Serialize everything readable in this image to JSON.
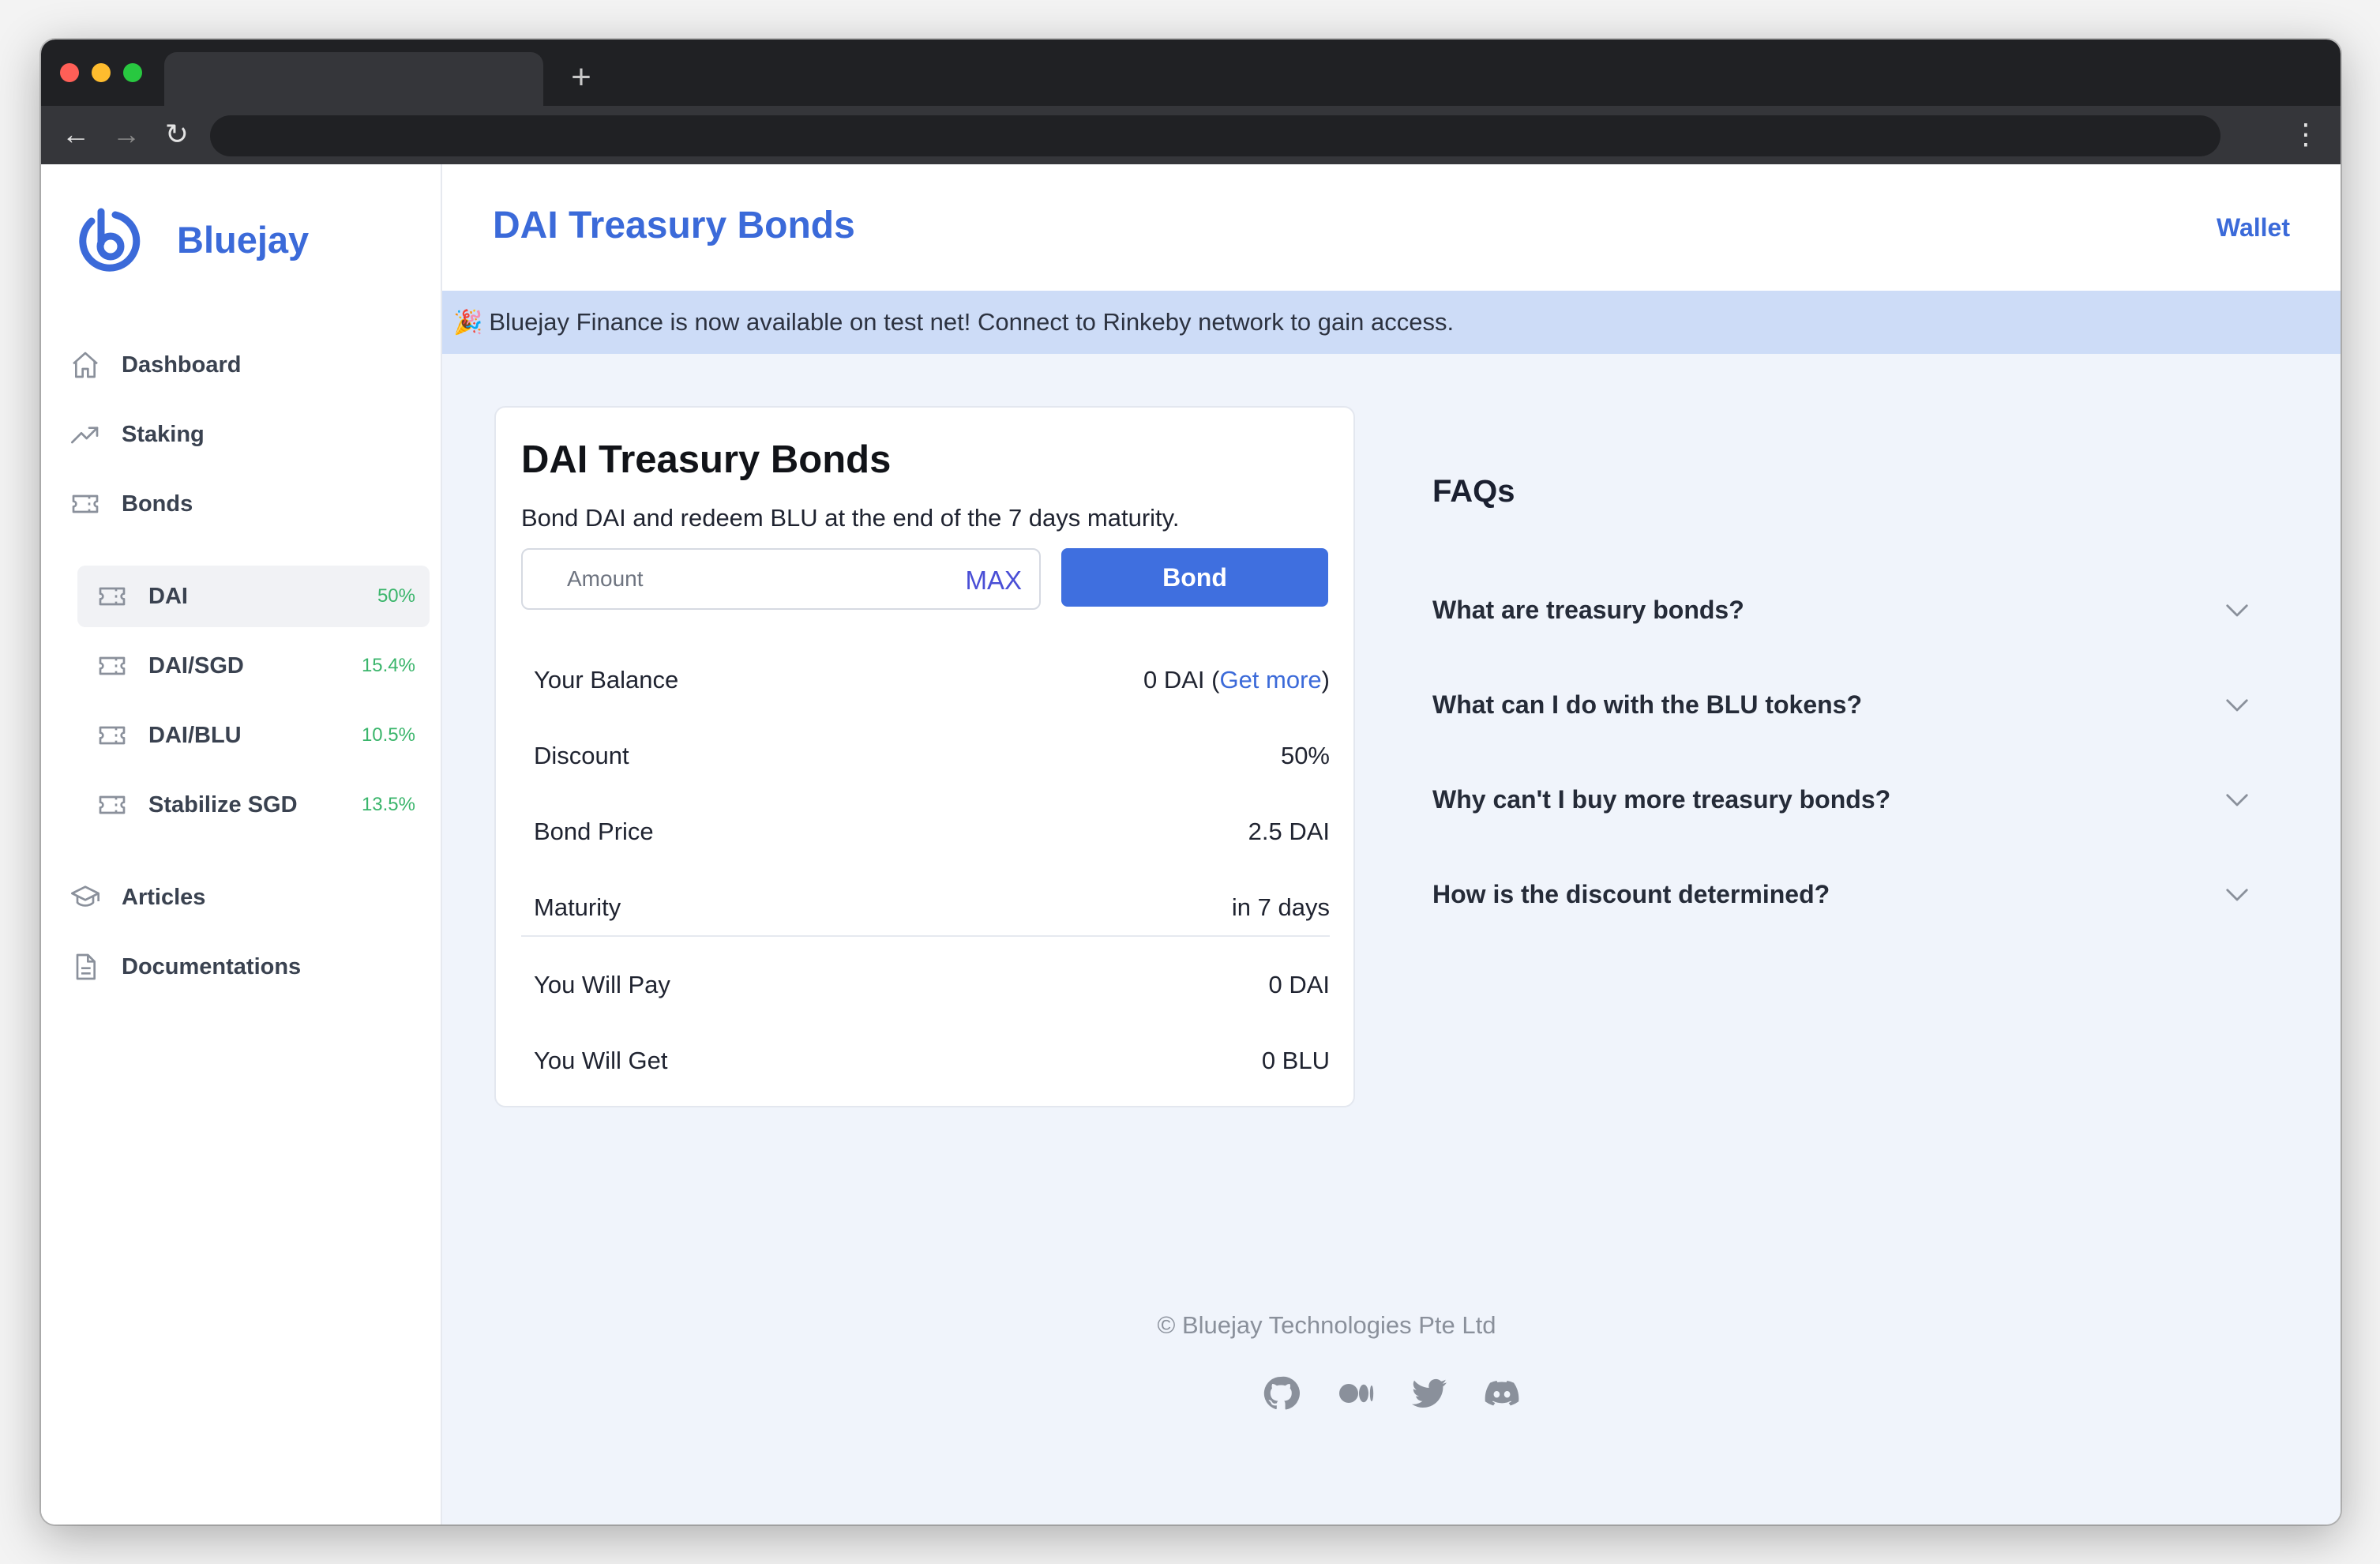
{
  "browser": {
    "new_tab_label": "+",
    "back_glyph": "←",
    "forward_glyph": "→",
    "reload_glyph": "↻",
    "menu_glyph": "⋮"
  },
  "sidebar": {
    "brand": "Bluejay",
    "items": [
      {
        "label": "Dashboard",
        "icon": "home-icon"
      },
      {
        "label": "Staking",
        "icon": "trending-up-icon"
      },
      {
        "label": "Bonds",
        "icon": "ticket-icon"
      },
      {
        "label": "Articles",
        "icon": "graduation-cap-icon"
      },
      {
        "label": "Documentations",
        "icon": "document-icon"
      }
    ],
    "bonds": [
      {
        "label": "DAI",
        "pct": "50%",
        "active": true
      },
      {
        "label": "DAI/SGD",
        "pct": "15.4%"
      },
      {
        "label": "DAI/BLU",
        "pct": "10.5%"
      },
      {
        "label": "Stabilize SGD",
        "pct": "13.5%"
      }
    ]
  },
  "header": {
    "title": "DAI Treasury Bonds",
    "wallet": "Wallet"
  },
  "banner": {
    "emoji": "🎉",
    "text": "Bluejay Finance is now available on test net! Connect to Rinkeby network to gain access."
  },
  "bond_card": {
    "title": "DAI Treasury Bonds",
    "subtitle": "Bond DAI and redeem BLU at the end of the 7 days maturity.",
    "amount_placeholder": "Amount",
    "max_label": "MAX",
    "bond_label": "Bond",
    "balance_label": "Your Balance",
    "balance_value": "0 DAI",
    "balance_open": "(",
    "balance_link": "Get more",
    "balance_close": ")",
    "rows": [
      {
        "label": "Discount",
        "value": "50%"
      },
      {
        "label": "Bond Price",
        "value": "2.5 DAI"
      },
      {
        "label": "Maturity",
        "value": "in 7 days"
      },
      {
        "label": "You Will Pay",
        "value": "0 DAI"
      },
      {
        "label": "You Will Get",
        "value": "0 BLU"
      }
    ]
  },
  "faq": {
    "title": "FAQs",
    "items": [
      "What are treasury bonds?",
      "What can I do with the BLU tokens?",
      "Why can't I buy more treasury bonds?",
      "How is the discount determined?"
    ]
  },
  "footer": {
    "copyright": "© Bluejay Technologies Pte Ltd",
    "socials": [
      "github-icon",
      "medium-icon",
      "twitter-icon",
      "discord-icon"
    ]
  },
  "colors": {
    "accent": "#3b6ad9",
    "button": "#3f6fdf",
    "banner": "#cddcf7",
    "positive": "#3ab56b",
    "page_bg": "#f0f4fb"
  }
}
